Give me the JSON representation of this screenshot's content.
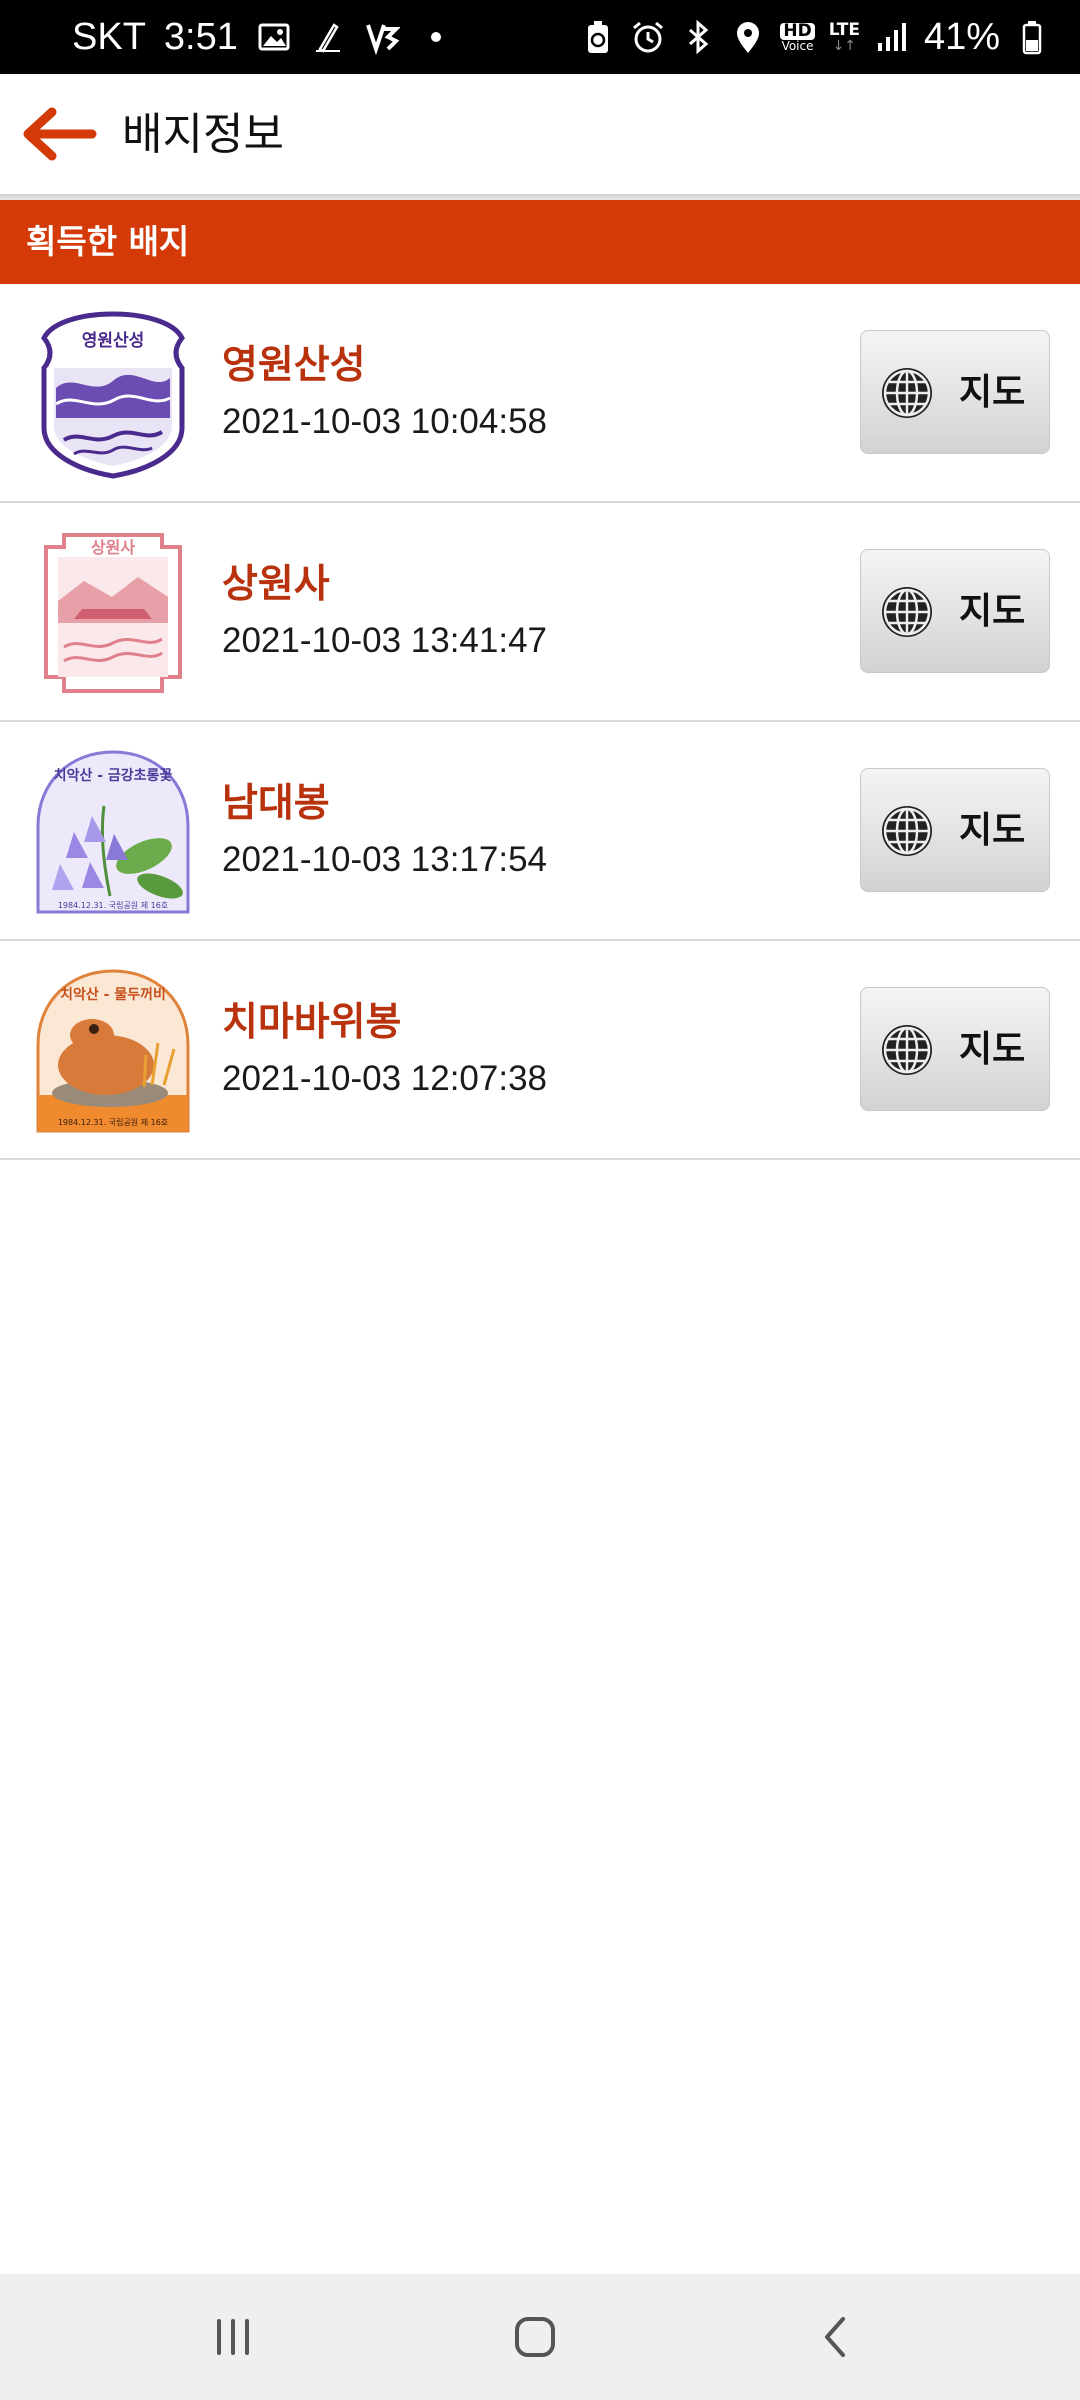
{
  "status_bar": {
    "carrier": "SKT",
    "time": "3:51",
    "battery_percent": "41%",
    "hd_label": "HD",
    "voice_label": "Voice",
    "lte_label": "LTE",
    "left_icons": [
      "gallery-icon",
      "pen-icon",
      "v3-icon",
      "dot-icon"
    ],
    "right_icons": [
      "battery-saver-icon",
      "alarm-icon",
      "bluetooth-icon",
      "location-icon",
      "hd-voice-icon",
      "lte-icon",
      "signal-icon",
      "battery-icon"
    ]
  },
  "app_bar": {
    "title": "배지정보",
    "back_icon": "back-arrow-icon",
    "accent_color": "#d43a08"
  },
  "section": {
    "label": "획득한 배지"
  },
  "badges": [
    {
      "name": "영원산성",
      "date": "2021-10-03 10:04:58",
      "map_label": "지도",
      "badge_text": "영원산성",
      "color": "#4a2a8c"
    },
    {
      "name": "상원사",
      "date": "2021-10-03 13:41:47",
      "map_label": "지도",
      "badge_text": "상원사",
      "color": "#e0808a"
    },
    {
      "name": "남대봉",
      "date": "2021-10-03 13:17:54",
      "map_label": "지도",
      "badge_text": "치악산 - 금강초롱꽃",
      "badge_footer": "1984.12.31. 국립공원 제 16호",
      "color": "#8a78d6"
    },
    {
      "name": "치마바위봉",
      "date": "2021-10-03 12:07:38",
      "map_label": "지도",
      "badge_text": "치악산 - 물두꺼비",
      "badge_footer": "1984.12.31. 국립공원 제 16호",
      "color": "#e0833a"
    }
  ],
  "nav_bar": {
    "icons": [
      "recent-apps-icon",
      "home-icon",
      "back-icon"
    ]
  }
}
